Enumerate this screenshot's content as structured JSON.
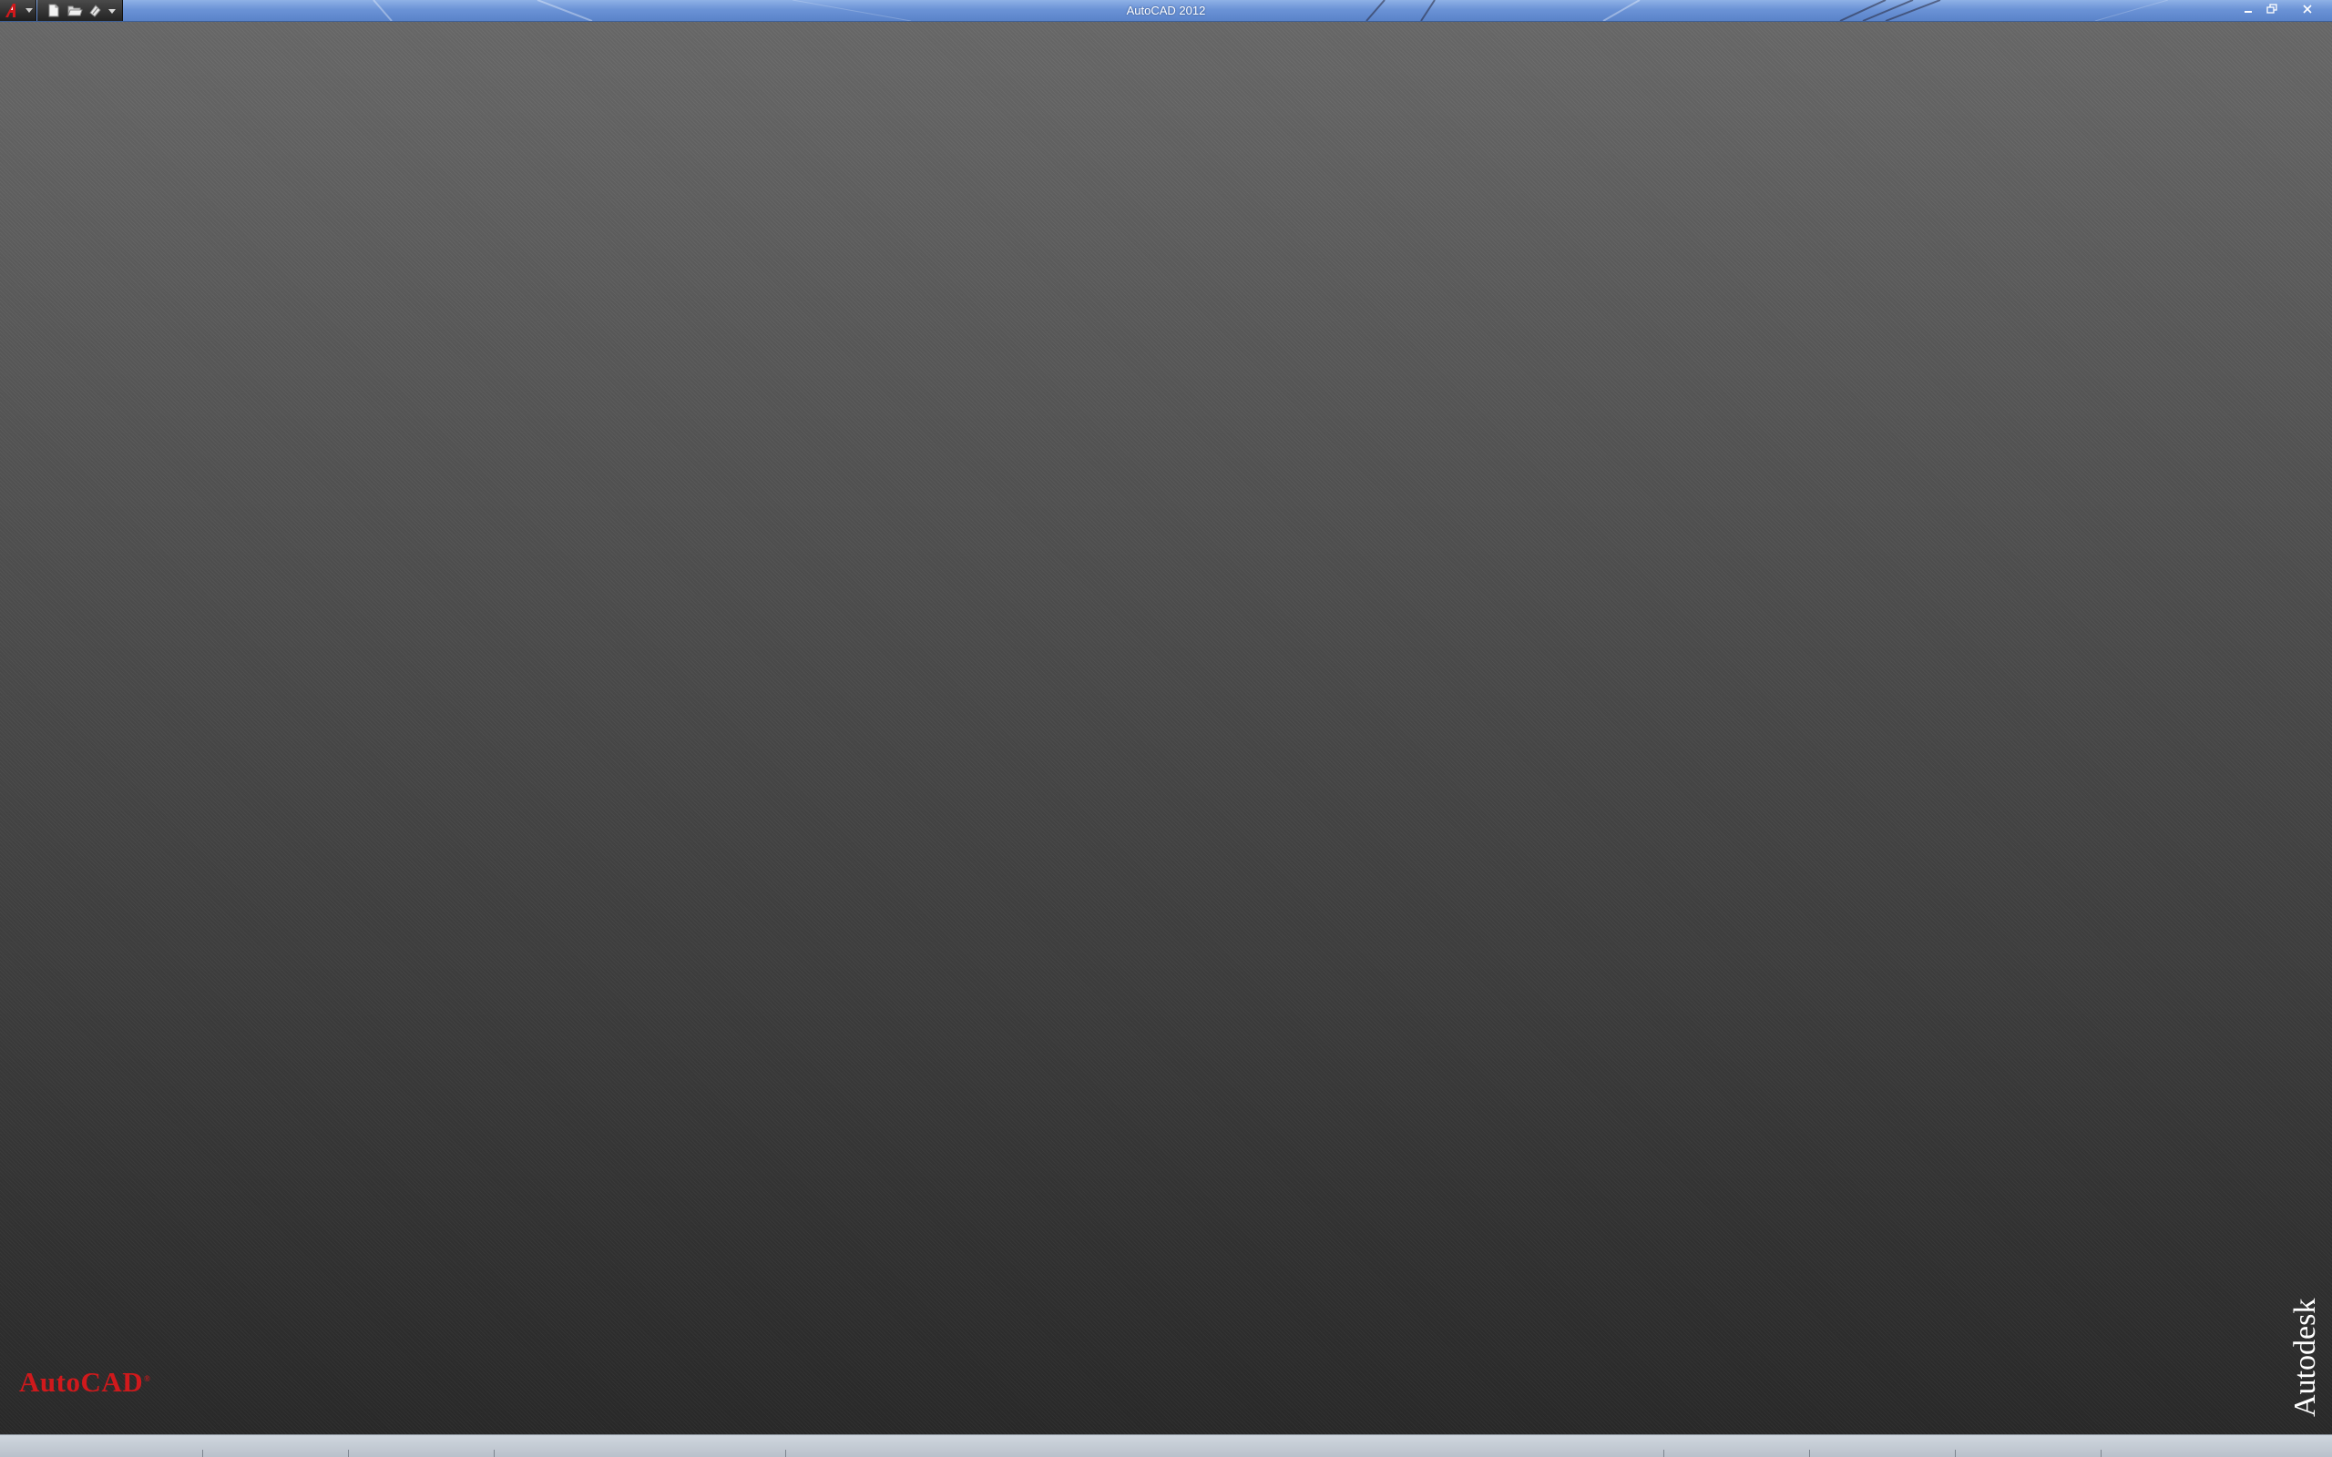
{
  "window": {
    "title": "AutoCAD 2012"
  },
  "branding": {
    "product_name": "AutoCAD",
    "product_mark": "®",
    "company_name": "Autodesk",
    "product_color": "#d0191c"
  },
  "title_bar": {
    "background_color": "#6b93d6",
    "app_button_icon": "autocad-a-logo-icon",
    "quick_access_icons": [
      "new-file-icon",
      "open-folder-icon",
      "save-icon",
      "customize-dropdown-icon"
    ],
    "window_controls": [
      "minimize-icon",
      "restore-icon",
      "close-icon"
    ]
  }
}
